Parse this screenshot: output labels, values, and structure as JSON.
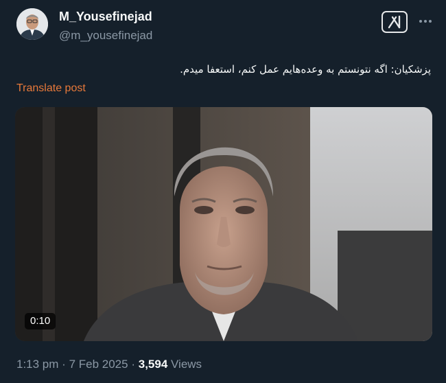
{
  "author": {
    "display_name": "M_Yousefinejad",
    "handle": "@m_yousefinejad",
    "avatar_icon": "profile-photo"
  },
  "actions": {
    "grok_icon": "grok-icon",
    "more_icon": "more-dots-icon"
  },
  "post": {
    "text": "پزشکیان: اگه نتونستم به وعده‌هایم عمل کنم، استعفا میدم.",
    "translate_label": "Translate post"
  },
  "media": {
    "duration": "0:10"
  },
  "meta": {
    "time": "1:13 pm",
    "separator": "·",
    "date": "7 Feb 2025",
    "views_count": "3,594",
    "views_label": "Views"
  },
  "colors": {
    "background": "#15202b",
    "text_primary": "#e7e9ea",
    "text_secondary": "#8b98a5",
    "translate_link": "#e8793a"
  }
}
